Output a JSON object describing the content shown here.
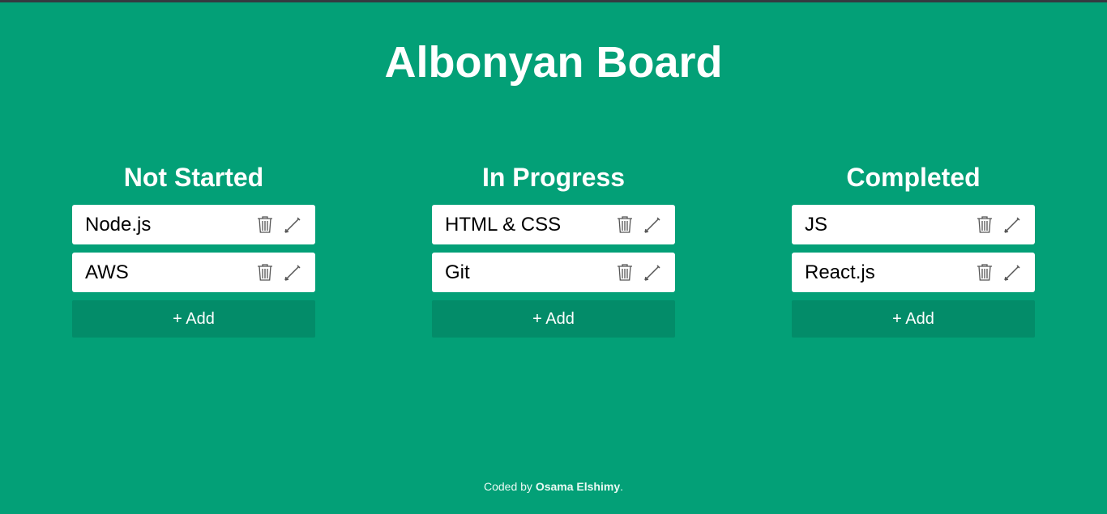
{
  "app": {
    "title": "Albonyan Board"
  },
  "columns": [
    {
      "title": "Not Started",
      "cards": [
        {
          "label": "Node.js"
        },
        {
          "label": "AWS"
        }
      ],
      "add_label": "+ Add"
    },
    {
      "title": "In Progress",
      "cards": [
        {
          "label": "HTML & CSS"
        },
        {
          "label": "Git"
        }
      ],
      "add_label": "+ Add"
    },
    {
      "title": "Completed",
      "cards": [
        {
          "label": "JS"
        },
        {
          "label": "React.js"
        }
      ],
      "add_label": "+ Add"
    }
  ],
  "footer": {
    "prefix": "Coded by ",
    "author": "Osama Elshimy",
    "suffix": "."
  },
  "icons": {
    "delete": "trash-icon",
    "edit": "pencil-icon"
  },
  "colors": {
    "background": "#03a077",
    "add_button": "#038c69",
    "card": "#ffffff",
    "top_border": "#343a40"
  }
}
